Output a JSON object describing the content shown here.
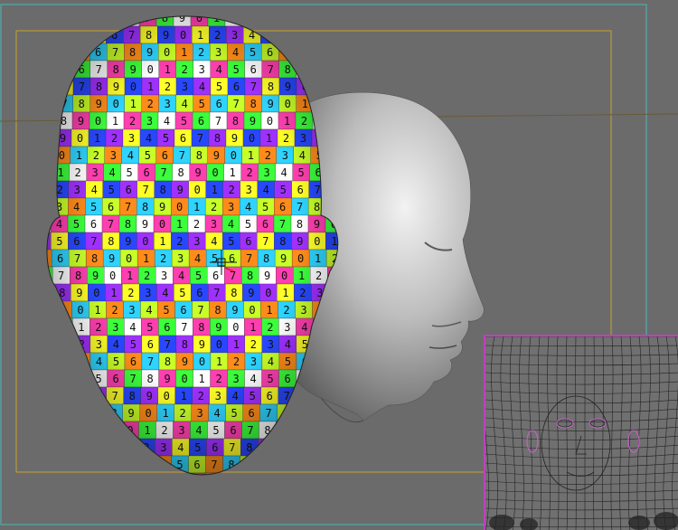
{
  "viewport": {
    "background": "#6b6b6b",
    "safe_frame_color": "#49b8b8",
    "render_region_color": "#c8a030",
    "horizon_color": "#6a5a3a",
    "icons": {
      "manipulator": "crosshair-gizmo-icon"
    }
  },
  "checker_texture": {
    "palette": [
      "#ff3fb0",
      "#ff8c1a",
      "#ffff28",
      "#3cff3c",
      "#2ed4ff",
      "#2848ff",
      "#ffffff",
      "#c8ff28",
      "#a030ff"
    ],
    "digits": [
      "1",
      "2",
      "3",
      "4",
      "5",
      "6",
      "7",
      "8",
      "9",
      "0"
    ]
  },
  "uv_editor": {
    "border_color": "#c040c0",
    "wire_color": "#222222",
    "highlight_color": "#d060d0"
  }
}
